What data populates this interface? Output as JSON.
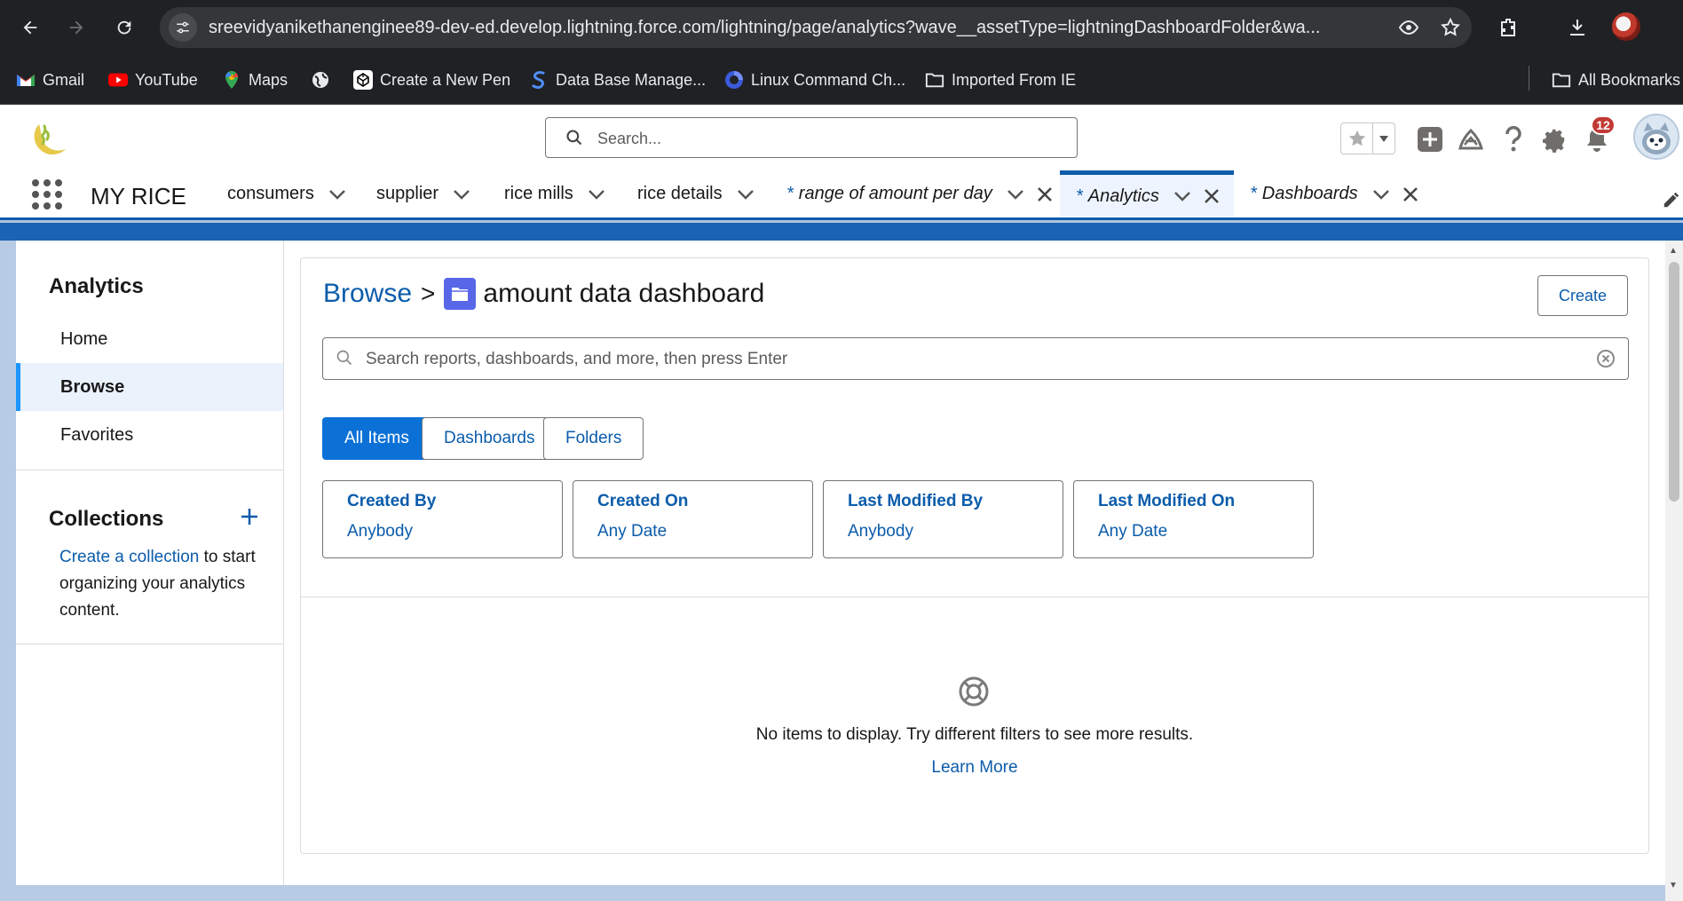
{
  "browser": {
    "url": "sreevidyanikethanenginee89-dev-ed.develop.lightning.force.com/lightning/page/analytics?wave__assetType=lightningDashboardFolder&wa...",
    "bookmarks": [
      {
        "label": "Gmail",
        "icon": "gmail-icon"
      },
      {
        "label": "YouTube",
        "icon": "youtube-icon"
      },
      {
        "label": "Maps",
        "icon": "maps-icon"
      },
      {
        "label": "",
        "icon": "globe-icon"
      },
      {
        "label": "Create a New Pen",
        "icon": "codepen-icon"
      },
      {
        "label": "Data Base Manage...",
        "icon": "s-logo-icon"
      },
      {
        "label": "Linux Command Ch...",
        "icon": "firefox-style-icon"
      },
      {
        "label": "Imported From IE",
        "icon": "folder-icon"
      }
    ],
    "all_bookmarks": "All Bookmarks"
  },
  "header": {
    "search_placeholder": "Search...",
    "notification_count": "12"
  },
  "app_nav": {
    "app_name": "MY RICE",
    "tabs": [
      {
        "label": "consumers"
      },
      {
        "label": "supplier"
      },
      {
        "label": "rice mills"
      },
      {
        "label": "rice details"
      },
      {
        "label": "range of amount per day",
        "prefix": "*"
      },
      {
        "label": "Analytics",
        "prefix": "*"
      },
      {
        "label": "Dashboards",
        "prefix": "*"
      }
    ]
  },
  "sidebar": {
    "title": "Analytics",
    "items": [
      {
        "label": "Home"
      },
      {
        "label": "Browse"
      },
      {
        "label": "Favorites"
      }
    ],
    "collections_title": "Collections",
    "collections_link": "Create a collection",
    "collections_text": " to start organizing your analytics content."
  },
  "main": {
    "breadcrumb_browse": "Browse",
    "breadcrumb_sep": ">",
    "folder_title": "amount data dashboard",
    "create_label": "Create",
    "search_placeholder": "Search reports, dashboards, and more, then press Enter",
    "filters": [
      {
        "label": "All Items"
      },
      {
        "label": "Dashboards"
      },
      {
        "label": "Folders"
      }
    ],
    "facets": [
      {
        "label": "Created By",
        "value": "Anybody"
      },
      {
        "label": "Created On",
        "value": "Any Date"
      },
      {
        "label": "Last Modified By",
        "value": "Anybody"
      },
      {
        "label": "Last Modified On",
        "value": "Any Date"
      }
    ],
    "empty_message": "No items to display. Try different filters to see more results.",
    "learn_more": "Learn More"
  },
  "colors": {
    "brand_blue": "#0b5cab",
    "button_blue": "#0b71d7",
    "badge_red": "#c23934"
  }
}
